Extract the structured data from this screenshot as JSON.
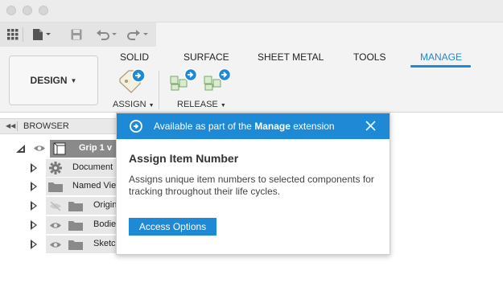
{
  "quick_access": {
    "icons": [
      "grid-icon",
      "file-icon",
      "save-icon",
      "undo-icon",
      "redo-icon"
    ]
  },
  "ribbon": {
    "workspace_label": "DESIGN",
    "tabs": [
      {
        "label": "SOLID",
        "active": false
      },
      {
        "label": "SURFACE",
        "active": false
      },
      {
        "label": "SHEET METAL",
        "active": false
      },
      {
        "label": "TOOLS",
        "active": false
      },
      {
        "label": "MANAGE",
        "active": true
      }
    ],
    "groups": [
      {
        "label": "ASSIGN"
      },
      {
        "label": "RELEASE"
      }
    ],
    "accent_color": "#1e8ad6"
  },
  "browser": {
    "title": "BROWSER",
    "items": [
      {
        "label": "Grip 1 v",
        "icon": "component-icon"
      },
      {
        "label": "Document",
        "icon": "gear-icon"
      },
      {
        "label": "Named Vie",
        "icon": "folder-icon"
      },
      {
        "label": "Origin",
        "icon": "folder-icon"
      },
      {
        "label": "Bodie",
        "icon": "folder-icon"
      },
      {
        "label": "Sketc",
        "icon": "folder-icon"
      }
    ]
  },
  "popup": {
    "banner_prefix": "Available as part of the ",
    "banner_bold": "Manage",
    "banner_suffix": " extension",
    "title": "Assign Item Number",
    "description": "Assigns unique item numbers to selected components for tracking throughout their life cycles.",
    "button_label": "Access Options"
  }
}
